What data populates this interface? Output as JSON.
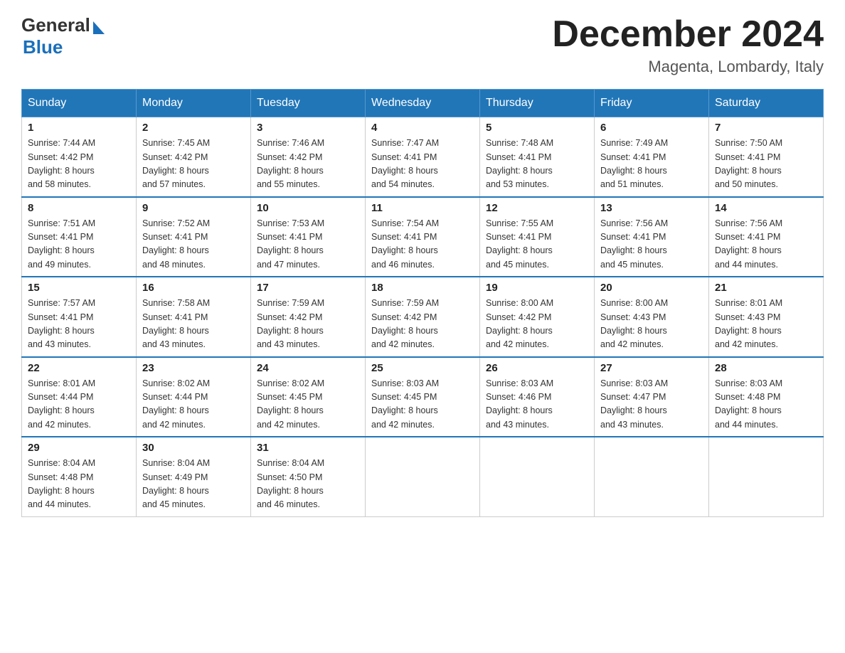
{
  "header": {
    "logo_general": "General",
    "logo_blue": "Blue",
    "month_title": "December 2024",
    "location": "Magenta, Lombardy, Italy"
  },
  "days_of_week": [
    "Sunday",
    "Monday",
    "Tuesday",
    "Wednesday",
    "Thursday",
    "Friday",
    "Saturday"
  ],
  "weeks": [
    [
      {
        "day": "1",
        "sunrise": "7:44 AM",
        "sunset": "4:42 PM",
        "daylight": "8 hours and 58 minutes."
      },
      {
        "day": "2",
        "sunrise": "7:45 AM",
        "sunset": "4:42 PM",
        "daylight": "8 hours and 57 minutes."
      },
      {
        "day": "3",
        "sunrise": "7:46 AM",
        "sunset": "4:42 PM",
        "daylight": "8 hours and 55 minutes."
      },
      {
        "day": "4",
        "sunrise": "7:47 AM",
        "sunset": "4:41 PM",
        "daylight": "8 hours and 54 minutes."
      },
      {
        "day": "5",
        "sunrise": "7:48 AM",
        "sunset": "4:41 PM",
        "daylight": "8 hours and 53 minutes."
      },
      {
        "day": "6",
        "sunrise": "7:49 AM",
        "sunset": "4:41 PM",
        "daylight": "8 hours and 51 minutes."
      },
      {
        "day": "7",
        "sunrise": "7:50 AM",
        "sunset": "4:41 PM",
        "daylight": "8 hours and 50 minutes."
      }
    ],
    [
      {
        "day": "8",
        "sunrise": "7:51 AM",
        "sunset": "4:41 PM",
        "daylight": "8 hours and 49 minutes."
      },
      {
        "day": "9",
        "sunrise": "7:52 AM",
        "sunset": "4:41 PM",
        "daylight": "8 hours and 48 minutes."
      },
      {
        "day": "10",
        "sunrise": "7:53 AM",
        "sunset": "4:41 PM",
        "daylight": "8 hours and 47 minutes."
      },
      {
        "day": "11",
        "sunrise": "7:54 AM",
        "sunset": "4:41 PM",
        "daylight": "8 hours and 46 minutes."
      },
      {
        "day": "12",
        "sunrise": "7:55 AM",
        "sunset": "4:41 PM",
        "daylight": "8 hours and 45 minutes."
      },
      {
        "day": "13",
        "sunrise": "7:56 AM",
        "sunset": "4:41 PM",
        "daylight": "8 hours and 45 minutes."
      },
      {
        "day": "14",
        "sunrise": "7:56 AM",
        "sunset": "4:41 PM",
        "daylight": "8 hours and 44 minutes."
      }
    ],
    [
      {
        "day": "15",
        "sunrise": "7:57 AM",
        "sunset": "4:41 PM",
        "daylight": "8 hours and 43 minutes."
      },
      {
        "day": "16",
        "sunrise": "7:58 AM",
        "sunset": "4:41 PM",
        "daylight": "8 hours and 43 minutes."
      },
      {
        "day": "17",
        "sunrise": "7:59 AM",
        "sunset": "4:42 PM",
        "daylight": "8 hours and 43 minutes."
      },
      {
        "day": "18",
        "sunrise": "7:59 AM",
        "sunset": "4:42 PM",
        "daylight": "8 hours and 42 minutes."
      },
      {
        "day": "19",
        "sunrise": "8:00 AM",
        "sunset": "4:42 PM",
        "daylight": "8 hours and 42 minutes."
      },
      {
        "day": "20",
        "sunrise": "8:00 AM",
        "sunset": "4:43 PM",
        "daylight": "8 hours and 42 minutes."
      },
      {
        "day": "21",
        "sunrise": "8:01 AM",
        "sunset": "4:43 PM",
        "daylight": "8 hours and 42 minutes."
      }
    ],
    [
      {
        "day": "22",
        "sunrise": "8:01 AM",
        "sunset": "4:44 PM",
        "daylight": "8 hours and 42 minutes."
      },
      {
        "day": "23",
        "sunrise": "8:02 AM",
        "sunset": "4:44 PM",
        "daylight": "8 hours and 42 minutes."
      },
      {
        "day": "24",
        "sunrise": "8:02 AM",
        "sunset": "4:45 PM",
        "daylight": "8 hours and 42 minutes."
      },
      {
        "day": "25",
        "sunrise": "8:03 AM",
        "sunset": "4:45 PM",
        "daylight": "8 hours and 42 minutes."
      },
      {
        "day": "26",
        "sunrise": "8:03 AM",
        "sunset": "4:46 PM",
        "daylight": "8 hours and 43 minutes."
      },
      {
        "day": "27",
        "sunrise": "8:03 AM",
        "sunset": "4:47 PM",
        "daylight": "8 hours and 43 minutes."
      },
      {
        "day": "28",
        "sunrise": "8:03 AM",
        "sunset": "4:48 PM",
        "daylight": "8 hours and 44 minutes."
      }
    ],
    [
      {
        "day": "29",
        "sunrise": "8:04 AM",
        "sunset": "4:48 PM",
        "daylight": "8 hours and 44 minutes."
      },
      {
        "day": "30",
        "sunrise": "8:04 AM",
        "sunset": "4:49 PM",
        "daylight": "8 hours and 45 minutes."
      },
      {
        "day": "31",
        "sunrise": "8:04 AM",
        "sunset": "4:50 PM",
        "daylight": "8 hours and 46 minutes."
      },
      null,
      null,
      null,
      null
    ]
  ],
  "labels": {
    "sunrise": "Sunrise:",
    "sunset": "Sunset:",
    "daylight": "Daylight:"
  }
}
